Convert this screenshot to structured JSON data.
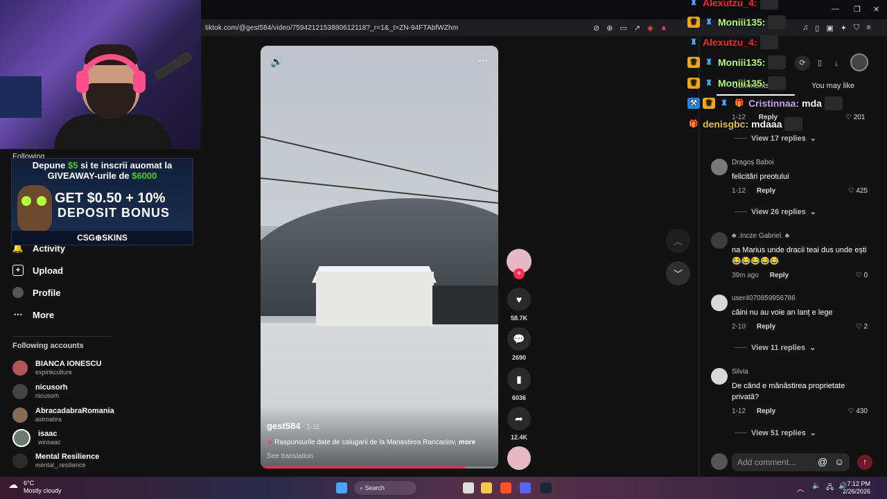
{
  "browser": {
    "url": "tiktok.com/@gest584/video/7594212153880612118?_r=1&_t=ZN-94FTAbfWZhm"
  },
  "sidebar": {
    "following_label": "Following",
    "nav": [
      {
        "label": "Activity",
        "icon": "bell-icon"
      },
      {
        "label": "Upload",
        "icon": "plus-square-icon"
      },
      {
        "label": "Profile",
        "icon": "profile-avatar-icon"
      },
      {
        "label": "More",
        "icon": "more-dots-icon"
      }
    ],
    "following_accounts_title": "Following accounts",
    "accounts": [
      {
        "name": "BIANCA IONESCU",
        "handle": "expinkculture"
      },
      {
        "name": "nicusorh",
        "handle": "nicusorh"
      },
      {
        "name": "AbracadabraRomania",
        "handle": "astroabra"
      },
      {
        "name": "isaac",
        "handle": "winsaac"
      },
      {
        "name": "Mental Resilience",
        "handle": "mental_.resilience"
      }
    ]
  },
  "ad": {
    "line1a": "Depune ",
    "line1b": "$5",
    "line1c": " si te inscrii auomat la",
    "line2a": "GIVEAWAY-urile de ",
    "line2b": "$6000",
    "big1": "GET $0.50 + 10%",
    "big2": "DEPOSIT BONUS",
    "brand": "CSG⊕SKINS"
  },
  "video": {
    "username": "gest584",
    "date": " · 1-11",
    "caption": "Raspunsurile date de calugarii de la Manastirea Rancaciov,",
    "more": "more",
    "translate": "See translation",
    "progress": 0.86
  },
  "actions": {
    "likes": "58.7K",
    "comments": "2690",
    "saves": "6036",
    "shares": "12.4K"
  },
  "comments_panel": {
    "tab_comments": "Comments",
    "tab_like": "You may like",
    "top_meta_date": "1-12",
    "top_meta_reply": "Reply",
    "top_likes": "201",
    "top_view_replies": "View 17 replies",
    "items": [
      {
        "user": "Dragoș Baboi",
        "text": "felicitări preotului",
        "date": "1-12",
        "reply": "Reply",
        "likes": "425",
        "view": "View 26 replies"
      },
      {
        "user": "♣ .Incze Gabriel. ♣",
        "text": "na Marius unde dracii teai dus unde ești 😂😂😂😂😂",
        "date": "39m ago",
        "reply": "Reply",
        "likes": "0",
        "view": ""
      },
      {
        "user": "user4070859956786",
        "text": "câini nu au voie an lanț e lege",
        "date": "2-10",
        "reply": "Reply",
        "likes": "2",
        "view": "View 11 replies"
      },
      {
        "user": "Silvia",
        "text": "De când e mănăstirea proprietate privată?",
        "date": "1-12",
        "reply": "Reply",
        "likes": "430",
        "view": "View 51 replies"
      }
    ],
    "add_comment_placeholder": "Add comment..."
  },
  "chat": [
    {
      "user": "Alexutzu_4:",
      "color": "#ff2a2a",
      "msg": "",
      "badges": [
        "robot"
      ]
    },
    {
      "user": "Moniii135:",
      "color": "#b6ff7a",
      "msg": "",
      "badges": [
        "crown",
        "robot"
      ]
    },
    {
      "user": "Alexutzu_4:",
      "color": "#ff2a2a",
      "msg": "",
      "badges": [
        "robot"
      ]
    },
    {
      "user": "Moniii135:",
      "color": "#b6ff7a",
      "msg": "",
      "badges": [
        "crown",
        "robot"
      ]
    },
    {
      "user": "Moniii135:",
      "color": "#b6ff7a",
      "msg": "",
      "badges": [
        "crown",
        "robot"
      ]
    },
    {
      "user": "Cristinnaa:",
      "color": "#c9a6ff",
      "msg": "mda",
      "badges": [
        "hammer",
        "crown",
        "robot",
        "gift"
      ]
    },
    {
      "user": "denisgbc:",
      "color": "#e6c35c",
      "msg": "mdaaa",
      "badges": [
        "gift"
      ]
    }
  ],
  "taskbar": {
    "weather_temp": "6°C",
    "weather_desc": "Mostly cloudy",
    "search": "Search",
    "time": "7:12 PM",
    "date": "2/26/2026"
  }
}
